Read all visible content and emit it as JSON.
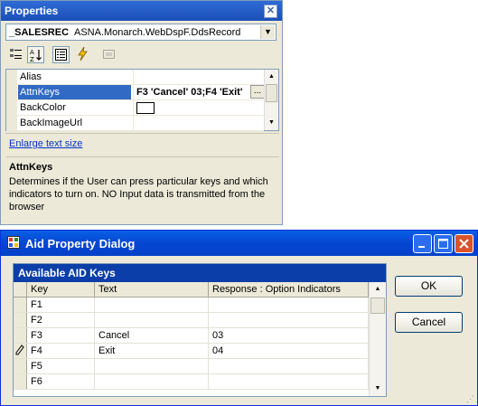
{
  "properties_panel": {
    "title": "Properties",
    "close_glyph": "✕",
    "object_name": "_SALESREC",
    "object_type": "ASNA.Monarch.WebDspF.DdsRecord",
    "toolbar": {
      "categorized_icon": "categorized-icon",
      "alphabetical_icon": "alphabetical-icon",
      "properties_icon": "properties-icon",
      "events_icon": "events-icon",
      "property_pages_icon": "property-pages-icon"
    },
    "rows": [
      {
        "name": "Alias",
        "value": ""
      },
      {
        "name": "AttnKeys",
        "value": "F3 'Cancel' 03;F4 'Exit'",
        "selected": true
      },
      {
        "name": "BackColor",
        "value": "",
        "swatch": "#ffffff"
      },
      {
        "name": "BackImageUrl",
        "value": ""
      }
    ],
    "ellipsis": "...",
    "enlarge_link": "Enlarge text size",
    "description_title": "AttnKeys",
    "description_text": "Determines if the User can press particular keys and which indicators to turn on. NO Input data is transmitted from the browser"
  },
  "dialog": {
    "title": "Aid Property Dialog",
    "grid_caption": "Available AID Keys",
    "columns": [
      "Key",
      "Text",
      "Response : Option Indicators"
    ],
    "rows": [
      {
        "key": "F1",
        "text": "",
        "response": ""
      },
      {
        "key": "F2",
        "text": "",
        "response": ""
      },
      {
        "key": "F3",
        "text": "Cancel",
        "response": "03"
      },
      {
        "key": "F4",
        "text": "Exit",
        "response": "04",
        "editing": true
      },
      {
        "key": "F5",
        "text": "",
        "response": ""
      },
      {
        "key": "F6",
        "text": "",
        "response": ""
      }
    ],
    "ok_label": "OK",
    "cancel_label": "Cancel"
  },
  "colors": {
    "selection": "#316ac5",
    "xp_title": "#0446d0",
    "grid_caption": "#0b3ea8"
  }
}
